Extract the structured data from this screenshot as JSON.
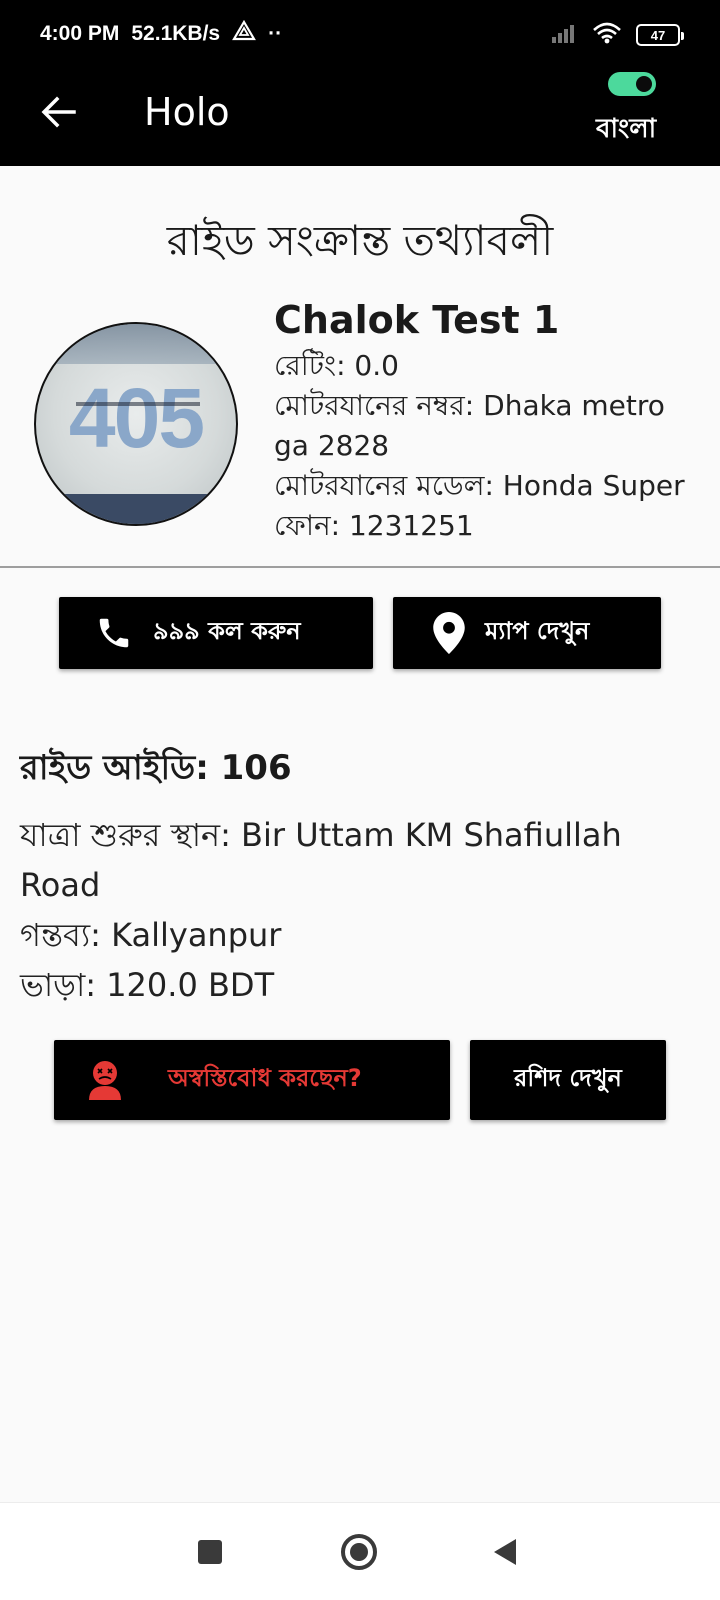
{
  "status_bar": {
    "time": "4:00 PM",
    "speed": "52.1KB/s",
    "dots": "··",
    "battery": "47"
  },
  "app_bar": {
    "title": "Holo",
    "language_label": "বাংলা",
    "language_toggle_on": true
  },
  "page": {
    "heading": "রাইড সংক্রান্ত তথ্যাবলী"
  },
  "driver": {
    "name": "Chalok Test 1",
    "rating": "রেটিং: 0.0",
    "vehicle_number": "মোটরযানের নম্বর: Dhaka metro ga 2828",
    "vehicle_model": "মোটরযানের মডেল: Honda Super",
    "phone": "ফোন: 1231251",
    "avatar_text": "405"
  },
  "actions": {
    "call_label": "৯৯৯ কল করুন",
    "map_label": "ম্যাপ দেখুন"
  },
  "ride": {
    "id": "রাইড আইডি: 106",
    "pickup": "যাত্রা শুরুর স্থান: Bir Uttam KM Shafiullah Road",
    "destination": "গন্তব্য: Kallyanpur",
    "fare": "ভাড়া: 120.0 BDT"
  },
  "bottom_actions": {
    "uncomfortable_label": "অস্বস্তিবোধ করছেন?",
    "receipt_label": "রশিদ দেখুন"
  },
  "colors": {
    "accent_green": "#4cd99c",
    "danger_red": "#e53935"
  }
}
